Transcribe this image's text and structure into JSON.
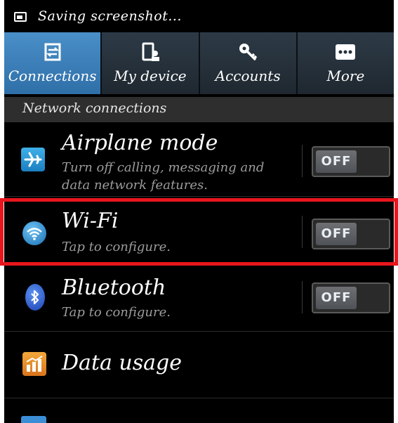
{
  "status_bar": {
    "text": "Saving screenshot..."
  },
  "tabs": [
    {
      "label": "Connections",
      "icon": "connections-icon",
      "active": true
    },
    {
      "label": "My device",
      "icon": "device-icon",
      "active": false
    },
    {
      "label": "Accounts",
      "icon": "key-icon",
      "active": false
    },
    {
      "label": "More",
      "icon": "more-icon",
      "active": false
    }
  ],
  "section": {
    "title": "Network connections"
  },
  "rows": {
    "airplane": {
      "title": "Airplane mode",
      "subtitle": "Turn off calling, messaging and data network features.",
      "toggle": "OFF",
      "icon": "airplane-icon"
    },
    "wifi": {
      "title": "Wi-Fi",
      "subtitle": "Tap to configure.",
      "toggle": "OFF",
      "icon": "wifi-icon"
    },
    "bluetooth": {
      "title": "Bluetooth",
      "subtitle": "Tap to configure.",
      "toggle": "OFF",
      "icon": "bluetooth-icon"
    },
    "data_usage": {
      "title": "Data usage",
      "icon": "data-usage-icon"
    }
  },
  "colors": {
    "active_tab": "#3f83bd",
    "highlight": "#e8161d",
    "tab_bar": "#26313b"
  }
}
